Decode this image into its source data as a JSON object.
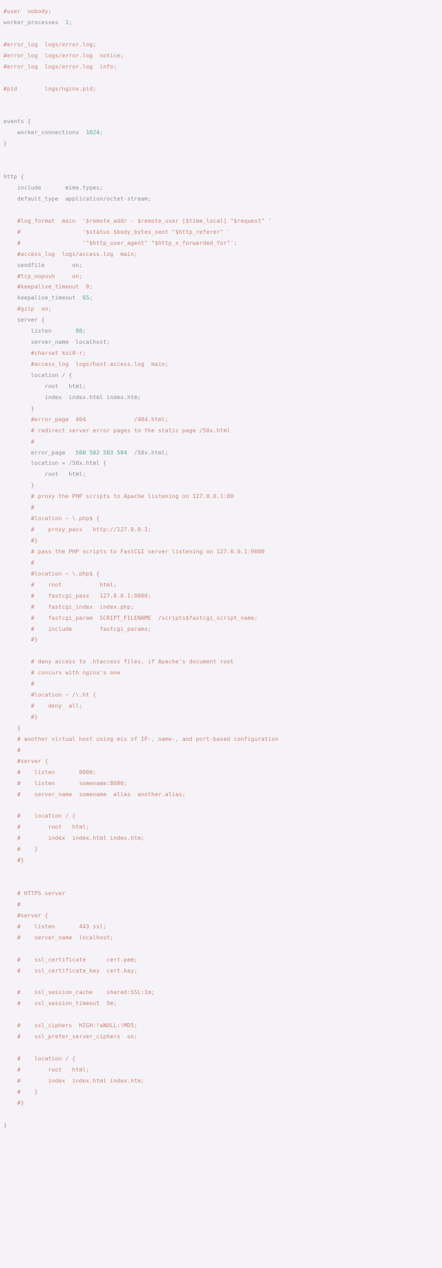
{
  "document": {
    "kind": "source-code-file",
    "language": "nginx",
    "theme": {
      "background": "#f5f3f7",
      "code_color": "#8d8d95",
      "comment_color": "#cb8274",
      "number_color": "#5aa596"
    },
    "lines": [
      {
        "n": 1,
        "tokens": [
          {
            "t": "comment",
            "s": "#user  nobody;"
          }
        ]
      },
      {
        "n": 2,
        "tokens": [
          {
            "t": "code",
            "s": "worker_processes  "
          },
          {
            "t": "number",
            "s": "1"
          },
          {
            "t": "code",
            "s": ";"
          }
        ]
      },
      {
        "n": 3,
        "tokens": [
          {
            "t": "blank",
            "s": ""
          }
        ]
      },
      {
        "n": 4,
        "tokens": [
          {
            "t": "comment",
            "s": "#error_log  logs/error.log;"
          }
        ]
      },
      {
        "n": 5,
        "tokens": [
          {
            "t": "comment",
            "s": "#error_log  logs/error.log  notice;"
          }
        ]
      },
      {
        "n": 6,
        "tokens": [
          {
            "t": "comment",
            "s": "#error_log  logs/error.log  info;"
          }
        ]
      },
      {
        "n": 7,
        "tokens": [
          {
            "t": "blank",
            "s": ""
          }
        ]
      },
      {
        "n": 8,
        "tokens": [
          {
            "t": "comment",
            "s": "#pid        logs/nginx.pid;"
          }
        ]
      },
      {
        "n": 9,
        "tokens": [
          {
            "t": "blank",
            "s": ""
          }
        ]
      },
      {
        "n": 10,
        "tokens": [
          {
            "t": "blank",
            "s": ""
          }
        ]
      },
      {
        "n": 11,
        "tokens": [
          {
            "t": "code",
            "s": "events {"
          }
        ]
      },
      {
        "n": 12,
        "tokens": [
          {
            "t": "code",
            "s": "    worker_connections  "
          },
          {
            "t": "number",
            "s": "1024"
          },
          {
            "t": "code",
            "s": ";"
          }
        ]
      },
      {
        "n": 13,
        "tokens": [
          {
            "t": "code",
            "s": "}"
          }
        ]
      },
      {
        "n": 14,
        "tokens": [
          {
            "t": "blank",
            "s": ""
          }
        ]
      },
      {
        "n": 15,
        "tokens": [
          {
            "t": "blank",
            "s": ""
          }
        ]
      },
      {
        "n": 16,
        "tokens": [
          {
            "t": "code",
            "s": "http {"
          }
        ]
      },
      {
        "n": 17,
        "tokens": [
          {
            "t": "code",
            "s": "    include       mime.types;"
          }
        ]
      },
      {
        "n": 18,
        "tokens": [
          {
            "t": "code",
            "s": "    default_type  application/octet-stream;"
          }
        ]
      },
      {
        "n": 19,
        "tokens": [
          {
            "t": "blank",
            "s": ""
          }
        ]
      },
      {
        "n": 20,
        "tokens": [
          {
            "t": "comment",
            "s": "    #log_format  main  '$remote_addr - $remote_user [$time_local] \"$request\" '"
          }
        ]
      },
      {
        "n": 21,
        "tokens": [
          {
            "t": "comment",
            "s": "    #                  '$status $body_bytes_sent \"$http_referer\" '"
          }
        ]
      },
      {
        "n": 22,
        "tokens": [
          {
            "t": "comment",
            "s": "    #                  '\"$http_user_agent\" \"$http_x_forwarded_for\"';"
          }
        ]
      },
      {
        "n": 23,
        "tokens": [
          {
            "t": "comment",
            "s": "    #access_log  logs/access.log  main;"
          }
        ]
      },
      {
        "n": 24,
        "tokens": [
          {
            "t": "code",
            "s": "    sendfile        on;"
          }
        ]
      },
      {
        "n": 25,
        "tokens": [
          {
            "t": "comment",
            "s": "    #tcp_nopush     on;"
          }
        ]
      },
      {
        "n": 26,
        "tokens": [
          {
            "t": "comment",
            "s": "    #keepalive_timeout  0;"
          }
        ]
      },
      {
        "n": 27,
        "tokens": [
          {
            "t": "code",
            "s": "    keepalive_timeout  "
          },
          {
            "t": "number",
            "s": "65"
          },
          {
            "t": "code",
            "s": ";"
          }
        ]
      },
      {
        "n": 28,
        "tokens": [
          {
            "t": "comment",
            "s": "    #gzip  on;"
          }
        ]
      },
      {
        "n": 29,
        "tokens": [
          {
            "t": "code",
            "s": "    server {"
          }
        ]
      },
      {
        "n": 30,
        "tokens": [
          {
            "t": "code",
            "s": "        listen       "
          },
          {
            "t": "number",
            "s": "80"
          },
          {
            "t": "code",
            "s": ";"
          }
        ]
      },
      {
        "n": 31,
        "tokens": [
          {
            "t": "code",
            "s": "        server_name  localhost;"
          }
        ]
      },
      {
        "n": 32,
        "tokens": [
          {
            "t": "comment",
            "s": "        #charset koi8-r;"
          }
        ]
      },
      {
        "n": 33,
        "tokens": [
          {
            "t": "comment",
            "s": "        #access_log  logs/host.access.log  main;"
          }
        ]
      },
      {
        "n": 34,
        "tokens": [
          {
            "t": "code",
            "s": "        location / {"
          }
        ]
      },
      {
        "n": 35,
        "tokens": [
          {
            "t": "code",
            "s": "            root   html;"
          }
        ]
      },
      {
        "n": 36,
        "tokens": [
          {
            "t": "code",
            "s": "            index  index.html index.htm;"
          }
        ]
      },
      {
        "n": 37,
        "tokens": [
          {
            "t": "code",
            "s": "        }"
          }
        ]
      },
      {
        "n": 38,
        "tokens": [
          {
            "t": "comment",
            "s": "        #error_page  404              /404.html;"
          }
        ]
      },
      {
        "n": 39,
        "tokens": [
          {
            "t": "comment",
            "s": "        # redirect server error pages to the static page /50x.html"
          }
        ]
      },
      {
        "n": 40,
        "tokens": [
          {
            "t": "comment",
            "s": "        #"
          }
        ]
      },
      {
        "n": 41,
        "tokens": [
          {
            "t": "code",
            "s": "        error_page   "
          },
          {
            "t": "number",
            "s": "500"
          },
          {
            "t": "code",
            "s": " "
          },
          {
            "t": "number",
            "s": "502"
          },
          {
            "t": "code",
            "s": " "
          },
          {
            "t": "number",
            "s": "503"
          },
          {
            "t": "code",
            "s": " "
          },
          {
            "t": "number",
            "s": "504"
          },
          {
            "t": "code",
            "s": "  /50x.html;"
          }
        ]
      },
      {
        "n": 42,
        "tokens": [
          {
            "t": "code",
            "s": "        location = /50x.html {"
          }
        ]
      },
      {
        "n": 43,
        "tokens": [
          {
            "t": "code",
            "s": "            root   html;"
          }
        ]
      },
      {
        "n": 44,
        "tokens": [
          {
            "t": "code",
            "s": "        }"
          }
        ]
      },
      {
        "n": 45,
        "tokens": [
          {
            "t": "comment",
            "s": "        # proxy the PHP scripts to Apache listening on 127.0.0.1:80"
          }
        ]
      },
      {
        "n": 46,
        "tokens": [
          {
            "t": "comment",
            "s": "        #"
          }
        ]
      },
      {
        "n": 47,
        "tokens": [
          {
            "t": "comment",
            "s": "        #location ~ \\.php$ {"
          }
        ]
      },
      {
        "n": 48,
        "tokens": [
          {
            "t": "comment",
            "s": "        #    proxy_pass   http://127.0.0.1;"
          }
        ]
      },
      {
        "n": 49,
        "tokens": [
          {
            "t": "comment",
            "s": "        #}"
          }
        ]
      },
      {
        "n": 50,
        "tokens": [
          {
            "t": "comment",
            "s": "        # pass the PHP scripts to FastCGI server listening on 127.0.0.1:9000"
          }
        ]
      },
      {
        "n": 51,
        "tokens": [
          {
            "t": "comment",
            "s": "        #"
          }
        ]
      },
      {
        "n": 52,
        "tokens": [
          {
            "t": "comment",
            "s": "        #location ~ \\.php$ {"
          }
        ]
      },
      {
        "n": 53,
        "tokens": [
          {
            "t": "comment",
            "s": "        #    root           html;"
          }
        ]
      },
      {
        "n": 54,
        "tokens": [
          {
            "t": "comment",
            "s": "        #    fastcgi_pass   127.0.0.1:9000;"
          }
        ]
      },
      {
        "n": 55,
        "tokens": [
          {
            "t": "comment",
            "s": "        #    fastcgi_index  index.php;"
          }
        ]
      },
      {
        "n": 56,
        "tokens": [
          {
            "t": "comment",
            "s": "        #    fastcgi_param  SCRIPT_FILENAME  /scripts$fastcgi_script_name;"
          }
        ]
      },
      {
        "n": 57,
        "tokens": [
          {
            "t": "comment",
            "s": "        #    include        fastcgi_params;"
          }
        ]
      },
      {
        "n": 58,
        "tokens": [
          {
            "t": "comment",
            "s": "        #}"
          }
        ]
      },
      {
        "n": 59,
        "tokens": [
          {
            "t": "blank",
            "s": ""
          }
        ]
      },
      {
        "n": 60,
        "tokens": [
          {
            "t": "comment",
            "s": "        # deny access to .htaccess files, if Apache's document root"
          }
        ]
      },
      {
        "n": 61,
        "tokens": [
          {
            "t": "comment",
            "s": "        # concurs with nginx's one"
          }
        ]
      },
      {
        "n": 62,
        "tokens": [
          {
            "t": "comment",
            "s": "        #"
          }
        ]
      },
      {
        "n": 63,
        "tokens": [
          {
            "t": "comment",
            "s": "        #location ~ /\\.ht {"
          }
        ]
      },
      {
        "n": 64,
        "tokens": [
          {
            "t": "comment",
            "s": "        #    deny  all;"
          }
        ]
      },
      {
        "n": 65,
        "tokens": [
          {
            "t": "comment",
            "s": "        #}"
          }
        ]
      },
      {
        "n": 66,
        "tokens": [
          {
            "t": "code",
            "s": "    }"
          }
        ]
      },
      {
        "n": 67,
        "tokens": [
          {
            "t": "comment",
            "s": "    # another virtual host using mix of IP-, name-, and port-based configuration"
          }
        ]
      },
      {
        "n": 68,
        "tokens": [
          {
            "t": "comment",
            "s": "    #"
          }
        ]
      },
      {
        "n": 69,
        "tokens": [
          {
            "t": "comment",
            "s": "    #server {"
          }
        ]
      },
      {
        "n": 70,
        "tokens": [
          {
            "t": "comment",
            "s": "    #    listen       8000;"
          }
        ]
      },
      {
        "n": 71,
        "tokens": [
          {
            "t": "comment",
            "s": "    #    listen       somename:8080;"
          }
        ]
      },
      {
        "n": 72,
        "tokens": [
          {
            "t": "comment",
            "s": "    #    server_name  somename  alias  another.alias;"
          }
        ]
      },
      {
        "n": 73,
        "tokens": [
          {
            "t": "blank",
            "s": ""
          }
        ]
      },
      {
        "n": 74,
        "tokens": [
          {
            "t": "comment",
            "s": "    #    location / {"
          }
        ]
      },
      {
        "n": 75,
        "tokens": [
          {
            "t": "comment",
            "s": "    #        root   html;"
          }
        ]
      },
      {
        "n": 76,
        "tokens": [
          {
            "t": "comment",
            "s": "    #        index  index.html index.htm;"
          }
        ]
      },
      {
        "n": 77,
        "tokens": [
          {
            "t": "comment",
            "s": "    #    }"
          }
        ]
      },
      {
        "n": 78,
        "tokens": [
          {
            "t": "comment",
            "s": "    #}"
          }
        ]
      },
      {
        "n": 79,
        "tokens": [
          {
            "t": "blank",
            "s": ""
          }
        ]
      },
      {
        "n": 80,
        "tokens": [
          {
            "t": "blank",
            "s": ""
          }
        ]
      },
      {
        "n": 81,
        "tokens": [
          {
            "t": "comment",
            "s": "    # HTTPS server"
          }
        ]
      },
      {
        "n": 82,
        "tokens": [
          {
            "t": "comment",
            "s": "    #"
          }
        ]
      },
      {
        "n": 83,
        "tokens": [
          {
            "t": "comment",
            "s": "    #server {"
          }
        ]
      },
      {
        "n": 84,
        "tokens": [
          {
            "t": "comment",
            "s": "    #    listen       443 ssl;"
          }
        ]
      },
      {
        "n": 85,
        "tokens": [
          {
            "t": "comment",
            "s": "    #    server_name  localhost;"
          }
        ]
      },
      {
        "n": 86,
        "tokens": [
          {
            "t": "blank",
            "s": ""
          }
        ]
      },
      {
        "n": 87,
        "tokens": [
          {
            "t": "comment",
            "s": "    #    ssl_certificate      cert.pem;"
          }
        ]
      },
      {
        "n": 88,
        "tokens": [
          {
            "t": "comment",
            "s": "    #    ssl_certificate_key  cert.key;"
          }
        ]
      },
      {
        "n": 89,
        "tokens": [
          {
            "t": "blank",
            "s": ""
          }
        ]
      },
      {
        "n": 90,
        "tokens": [
          {
            "t": "comment",
            "s": "    #    ssl_session_cache    shared:SSL:1m;"
          }
        ]
      },
      {
        "n": 91,
        "tokens": [
          {
            "t": "comment",
            "s": "    #    ssl_session_timeout  5m;"
          }
        ]
      },
      {
        "n": 92,
        "tokens": [
          {
            "t": "blank",
            "s": ""
          }
        ]
      },
      {
        "n": 93,
        "tokens": [
          {
            "t": "comment",
            "s": "    #    ssl_ciphers  HIGH:!aNULL:!MD5;"
          }
        ]
      },
      {
        "n": 94,
        "tokens": [
          {
            "t": "comment",
            "s": "    #    ssl_prefer_server_ciphers  on;"
          }
        ]
      },
      {
        "n": 95,
        "tokens": [
          {
            "t": "blank",
            "s": ""
          }
        ]
      },
      {
        "n": 96,
        "tokens": [
          {
            "t": "comment",
            "s": "    #    location / {"
          }
        ]
      },
      {
        "n": 97,
        "tokens": [
          {
            "t": "comment",
            "s": "    #        root   html;"
          }
        ]
      },
      {
        "n": 98,
        "tokens": [
          {
            "t": "comment",
            "s": "    #        index  index.html index.htm;"
          }
        ]
      },
      {
        "n": 99,
        "tokens": [
          {
            "t": "comment",
            "s": "    #    }"
          }
        ]
      },
      {
        "n": 100,
        "tokens": [
          {
            "t": "comment",
            "s": "    #}"
          }
        ]
      },
      {
        "n": 101,
        "tokens": [
          {
            "t": "blank",
            "s": ""
          }
        ]
      },
      {
        "n": 102,
        "tokens": [
          {
            "t": "code",
            "s": "}"
          }
        ]
      }
    ]
  }
}
